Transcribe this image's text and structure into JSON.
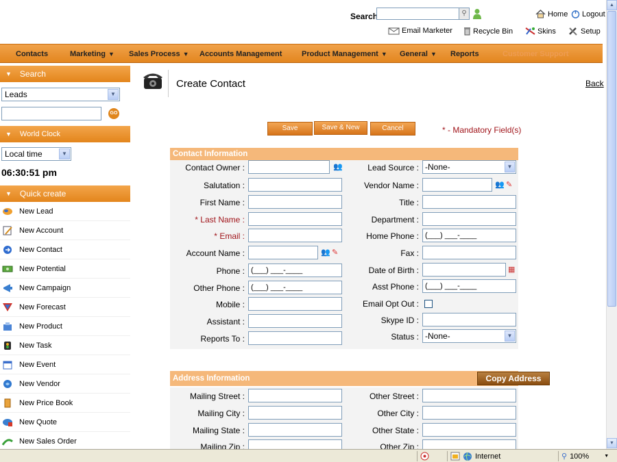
{
  "header": {
    "search_label": "Search",
    "search_value": "",
    "links": {
      "home": "Home",
      "logout": "Logout",
      "email_marketer": "Email Marketer",
      "recycle_bin": "Recycle Bin",
      "skins": "Skins",
      "setup": "Setup"
    }
  },
  "nav": {
    "items": [
      {
        "label": "Contacts",
        "dropdown": false
      },
      {
        "label": "Marketing",
        "dropdown": true
      },
      {
        "label": "Sales Process",
        "dropdown": true
      },
      {
        "label": "Accounts Management",
        "dropdown": false
      },
      {
        "label": "Product Management",
        "dropdown": true
      },
      {
        "label": "General",
        "dropdown": true
      },
      {
        "label": "Reports",
        "dropdown": false
      },
      {
        "label": "Customer Support",
        "dropdown": false
      }
    ]
  },
  "sidebar": {
    "search_title": "Search",
    "search_module": "Leads",
    "search_value": "",
    "go_label": "GO",
    "clock_title": "World Clock",
    "clock_zone": "Local time",
    "clock_time": "06:30:51 pm",
    "quick_title": "Quick create",
    "quick_items": [
      {
        "label": "New Lead",
        "icon": "lead-icon"
      },
      {
        "label": "New Account",
        "icon": "account-icon"
      },
      {
        "label": "New Contact",
        "icon": "contact-icon"
      },
      {
        "label": "New Potential",
        "icon": "potential-icon"
      },
      {
        "label": "New Campaign",
        "icon": "campaign-icon"
      },
      {
        "label": "New Forecast",
        "icon": "forecast-icon"
      },
      {
        "label": "New Product",
        "icon": "product-icon"
      },
      {
        "label": "New Task",
        "icon": "task-icon"
      },
      {
        "label": "New Event",
        "icon": "event-icon"
      },
      {
        "label": "New Vendor",
        "icon": "vendor-icon"
      },
      {
        "label": "New Price Book",
        "icon": "pricebook-icon"
      },
      {
        "label": "New Quote",
        "icon": "quote-icon"
      },
      {
        "label": "New Sales Order",
        "icon": "salesorder-icon"
      }
    ]
  },
  "page": {
    "title": "Create Contact",
    "back": "Back",
    "save": "Save",
    "save_new": "Save & New",
    "cancel": "Cancel",
    "mandatory": "* - Mandatory Field(s)"
  },
  "contact_info": {
    "title": "Contact Information",
    "left": [
      {
        "label": "Contact Owner :",
        "required": false,
        "value": ""
      },
      {
        "label": "Salutation :",
        "required": false,
        "value": ""
      },
      {
        "label": "First Name :",
        "required": false,
        "value": ""
      },
      {
        "label": "Last Name :",
        "required": true,
        "value": ""
      },
      {
        "label": "Email :",
        "required": true,
        "value": ""
      },
      {
        "label": "Account Name :",
        "required": false,
        "value": ""
      },
      {
        "label": "Phone :",
        "required": false,
        "value": "(___) ___-____"
      },
      {
        "label": "Other Phone :",
        "required": false,
        "value": "(___) ___-____"
      },
      {
        "label": "Mobile :",
        "required": false,
        "value": ""
      },
      {
        "label": "Assistant :",
        "required": false,
        "value": ""
      },
      {
        "label": "Reports To :",
        "required": false,
        "value": ""
      }
    ],
    "right": [
      {
        "label": "Lead Source :",
        "value": "-None-"
      },
      {
        "label": "Vendor Name :",
        "value": ""
      },
      {
        "label": "Title :",
        "value": ""
      },
      {
        "label": "Department :",
        "value": ""
      },
      {
        "label": "Home Phone :",
        "value": "(___) ___-____"
      },
      {
        "label": "Fax :",
        "value": ""
      },
      {
        "label": "Date of Birth :",
        "value": ""
      },
      {
        "label": "Asst Phone :",
        "value": "(___) ___-____"
      },
      {
        "label": "Email Opt Out :",
        "value": ""
      },
      {
        "label": "Skype ID :",
        "value": ""
      },
      {
        "label": "Status :",
        "value": "-None-"
      }
    ]
  },
  "address_info": {
    "title": "Address Information",
    "copy": "Copy Address",
    "left": [
      {
        "label": "Mailing Street :",
        "value": ""
      },
      {
        "label": "Mailing City :",
        "value": ""
      },
      {
        "label": "Mailing State :",
        "value": ""
      },
      {
        "label": "Mailing Zip :",
        "value": ""
      }
    ],
    "right": [
      {
        "label": "Other Street :",
        "value": ""
      },
      {
        "label": "Other City :",
        "value": ""
      },
      {
        "label": "Other State :",
        "value": ""
      },
      {
        "label": "Other Zip :",
        "value": ""
      }
    ]
  },
  "statusbar": {
    "zone": "Internet",
    "zoom": "100%"
  },
  "colors": {
    "accent": "#e3861f",
    "section": "#f5b87a",
    "required": "#a0141a"
  }
}
